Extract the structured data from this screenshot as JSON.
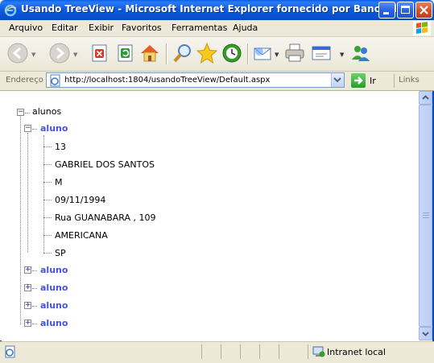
{
  "window": {
    "title": "Usando TreeView - Microsoft Internet Explorer fornecido por Banco d..."
  },
  "menu": {
    "items": [
      "Arquivo",
      "Editar",
      "Exibir",
      "Favoritos",
      "Ferramentas",
      "Ajuda"
    ]
  },
  "toolbar": {
    "icons": [
      "back-icon",
      "forward-icon",
      "stop-icon",
      "refresh-icon",
      "home-icon",
      "search-icon",
      "favorites-icon",
      "history-icon",
      "mail-icon",
      "print-icon",
      "edit-icon",
      "messenger-icon"
    ]
  },
  "address": {
    "label": "Endereço",
    "url": "http://localhost:1804/usandoTreeView/Default.aspx",
    "go_label": "Ir",
    "links_label": "Links"
  },
  "tree": {
    "root": "alunos",
    "expanded_branch": "aluno",
    "leaves": [
      "13",
      "GABRIEL DOS SANTOS",
      "M",
      "09/11/1994",
      "Rua GUANABARA , 109",
      "AMERICANA",
      "SP"
    ],
    "collapsed_branches": [
      "aluno",
      "aluno",
      "aluno",
      "aluno"
    ]
  },
  "status": {
    "zone": "Intranet local"
  },
  "colors": {
    "titlebar": "#0b5adc",
    "branch_text": "#4455dd",
    "chrome": "#ece9d8"
  }
}
